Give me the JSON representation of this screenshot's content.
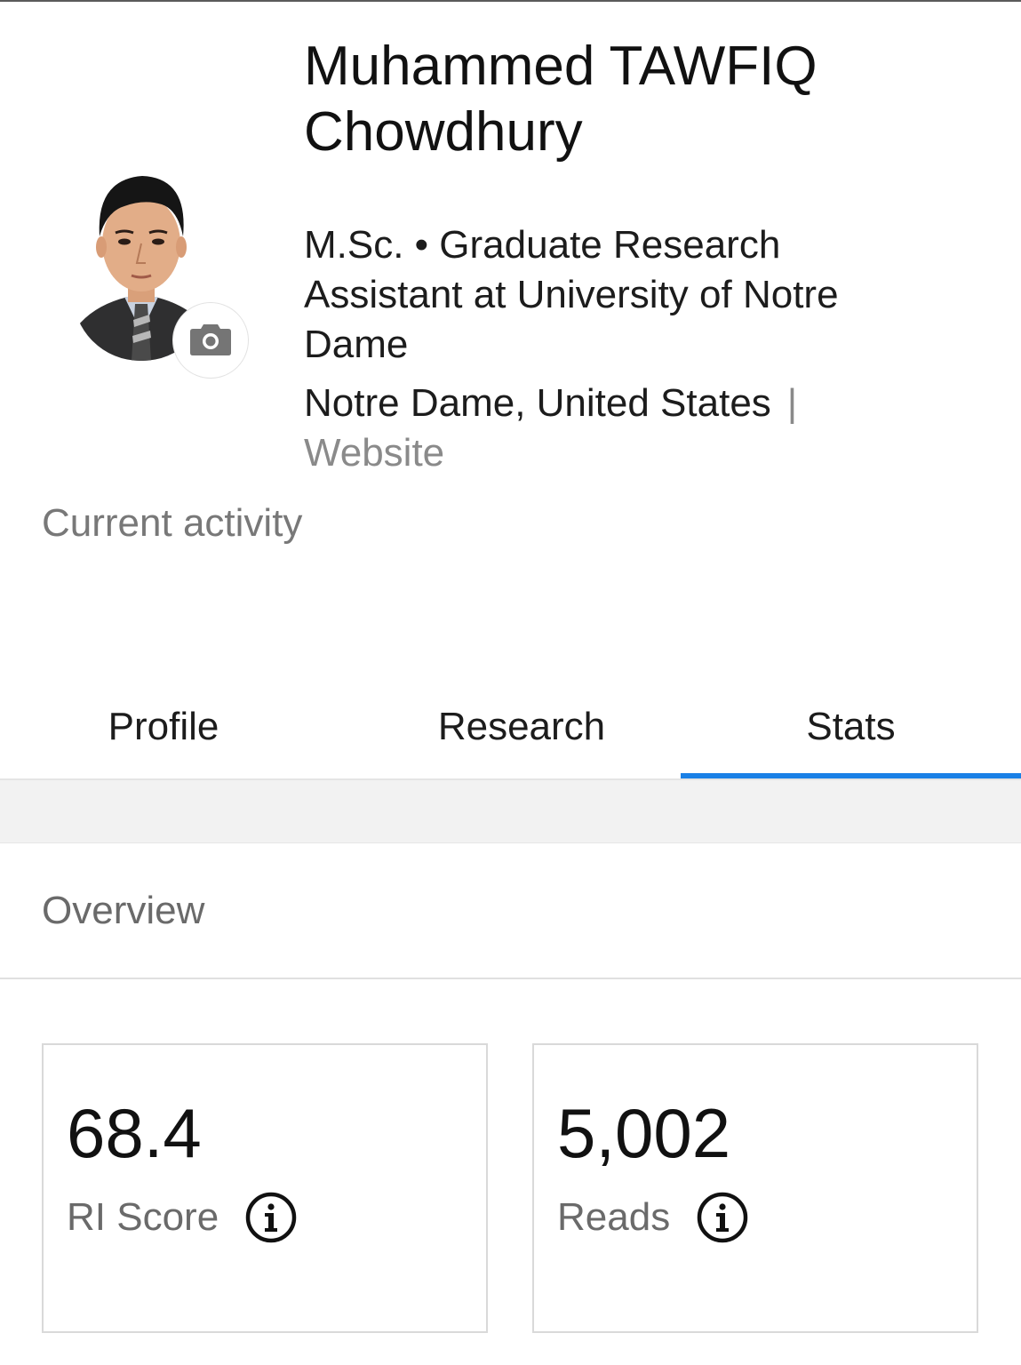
{
  "profile": {
    "name": "Muhammed TAWFIQ Chowdhury",
    "headline": "M.Sc. • Graduate Research Assistant at University of Notre Dame",
    "location": "Notre Dame, United States",
    "separator": "|",
    "website_label": "Website",
    "current_activity": "Current activity",
    "avatar_icon": "profile-photo",
    "camera_icon": "camera-icon"
  },
  "tabs": [
    {
      "label": "Profile",
      "active": false
    },
    {
      "label": "Research",
      "active": false
    },
    {
      "label": "Stats",
      "active": true
    }
  ],
  "overview": {
    "title": "Overview",
    "cards": [
      {
        "value": "68.4",
        "label": "RI Score",
        "icon": "info-icon"
      },
      {
        "value": "5,002",
        "label": "Reads",
        "icon": "info-icon"
      }
    ]
  },
  "colors": {
    "accent": "#1a80e6",
    "text_primary": "#111111",
    "text_secondary": "#787878",
    "band": "#f2f2f2"
  }
}
